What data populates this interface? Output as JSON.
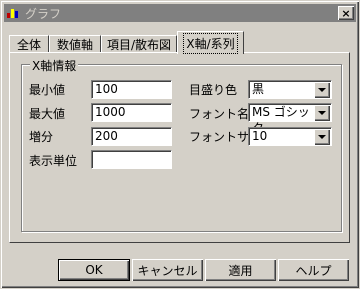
{
  "window": {
    "title": "グラフ",
    "close_label": "×"
  },
  "tabs": [
    {
      "label": "全体"
    },
    {
      "label": "数値軸"
    },
    {
      "label": "項目/散布図"
    },
    {
      "label": "X軸/系列",
      "active": true
    }
  ],
  "group": {
    "title": "X軸情報"
  },
  "fields": {
    "min": {
      "label": "最小値",
      "value": "100"
    },
    "max": {
      "label": "最大値",
      "value": "1000"
    },
    "step": {
      "label": "増分",
      "value": "200"
    },
    "unit": {
      "label": "表示単位",
      "value": ""
    },
    "tick_color": {
      "label": "目盛り色",
      "value": "黒"
    },
    "font_name": {
      "label": "フォント名",
      "value": "MS ゴシック"
    },
    "font_size": {
      "label": "フォントサイズ",
      "value": "10"
    }
  },
  "buttons": {
    "ok": "OK",
    "cancel": "キャンセル",
    "apply": "適用",
    "help": "ヘルプ"
  },
  "colors": {
    "face": "#d4d0c8",
    "titlebar_inactive": "#808080",
    "field_bg": "#ffffff"
  }
}
